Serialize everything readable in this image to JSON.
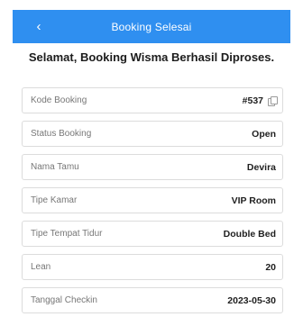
{
  "header": {
    "back_icon": "chevron-left-icon",
    "title": "Booking Selesai"
  },
  "message": "Selamat, Booking Wisma Berhasil Diproses.",
  "details": [
    {
      "label": "Kode Booking",
      "value": "#537"
    },
    {
      "label": "Status Booking",
      "value": "Open"
    },
    {
      "label": "Nama Tamu",
      "value": "Devira"
    },
    {
      "label": "Tipe Kamar",
      "value": "VIP Room"
    },
    {
      "label": "Tipe Tempat Tidur",
      "value": "Double Bed"
    },
    {
      "label": "Lean",
      "value": "20"
    },
    {
      "label": "Tanggal Checkin",
      "value": "2023-05-30"
    }
  ],
  "colors": {
    "accent": "#2f8ff0"
  }
}
